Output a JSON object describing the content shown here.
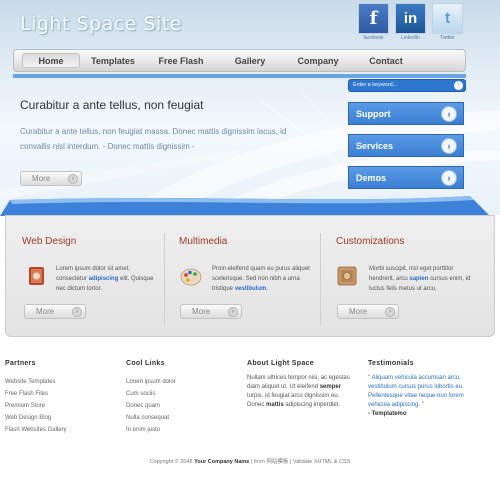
{
  "site_title": "Light Space Site",
  "social": [
    {
      "name": "Facebook",
      "glyph": "f",
      "label": "facebook"
    },
    {
      "name": "LinkedIn",
      "glyph": "in",
      "label": "LinkedIn"
    },
    {
      "name": "Twitter",
      "glyph": "t",
      "label": "Twitter"
    }
  ],
  "nav": [
    "Home",
    "Templates",
    "Free Flash",
    "Gallery",
    "Company",
    "Contact"
  ],
  "search": {
    "placeholder": "Enter a keyword..."
  },
  "side_buttons": [
    "Support",
    "Services",
    "Demos"
  ],
  "hero": {
    "title": "Curabitur a ante tellus, non feugiat",
    "text": "Curabitur a ante tellus, non feugiat massa. Donec mattis dignissim lacus, id convallis nisl interdum. - Donec mattis dignissim -",
    "more": "More"
  },
  "features": [
    {
      "title": "Web Design",
      "text_pre": "Lorem ipsum dolor sit amet, consectetur ",
      "highlight": "adipiscing",
      "text_post": " elit. Quisque nec dictum tortor.",
      "more": "More",
      "icon": "book-icon"
    },
    {
      "title": "Multimedia",
      "text_pre": "Proin eleifend quam eu purus aliquet scelerisque. Sed non nibh a urna tristique ",
      "highlight": "vestibulum",
      "text_post": ".",
      "more": "More",
      "icon": "palette-icon"
    },
    {
      "title": "Customizations",
      "text_pre": "Morbi suscipit, nisl eget porttitor hendrerit, arcu ",
      "highlight": "sapien",
      "text_post": " cursus enim, id luctus felis metus ut arcu.",
      "more": "More",
      "icon": "safe-icon"
    }
  ],
  "footer": {
    "partners": {
      "title": "Partners",
      "items": [
        "Website Templates",
        "Free Flash Files",
        "Premium Store",
        "Web Design Blog",
        "Flash Websites Gallery"
      ]
    },
    "cool_links": {
      "title": "Cool Links",
      "items": [
        "Lorem ipsum dolor",
        "Cum sociis",
        "Donec quam",
        "Nulla consequat",
        "In enim justo"
      ]
    },
    "about": {
      "title": "About Light Space",
      "text_1": "Nullam ultrices tempor nisi, ac egestas diam aliquet ut. Ut eleifend ",
      "bold_1": "semper",
      "text_2": " turpis, id feugiat arcu dignissim eu. Donec ",
      "bold_2": "mattis",
      "text_3": " adipiscing imperdiet."
    },
    "testimonials": {
      "title": "Testimonials",
      "quote": "\" Aliquam vehicula accumsan arcu, vestibulum cursus purus lobortis eu. Pellentesque vitae neque non lorem vehicula adipiscing. \"",
      "author": "- Templatemo"
    }
  },
  "copyright": {
    "pre": "Copyright © 2048 ",
    "company": "Your Company Name",
    "post": " | from 网站模板 | Validate XHTML & CSS"
  }
}
